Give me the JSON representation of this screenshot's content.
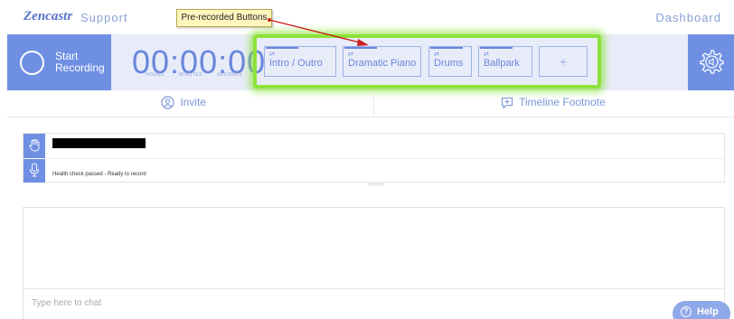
{
  "nav": {
    "logo": "Zencastr",
    "support": "Support",
    "dashboard": "Dashboard"
  },
  "annotation": {
    "callout": "Pre-recorded Buttons"
  },
  "recording": {
    "start_label": "Start Recording",
    "timer": "00:00:00",
    "units": {
      "hours": "HOURS",
      "minutes": "MINUTES",
      "seconds": "SECONDS"
    }
  },
  "prerecorded": [
    {
      "label": "Intro / Outro"
    },
    {
      "label": "Dramatic Piano"
    },
    {
      "label": "Drums"
    },
    {
      "label": "Ballpark"
    },
    {
      "label": "+"
    }
  ],
  "subnav": {
    "invite": "Invite",
    "footnote": "Timeline Footnote"
  },
  "participant": {
    "status": "Health check passed - Ready to record"
  },
  "chat": {
    "placeholder": "Type here to chat"
  },
  "help": {
    "label": "Help"
  },
  "colors": {
    "accent": "#6f8fe3",
    "timer": "#6a86dc",
    "highlight": "#8ce23a",
    "arrow": "#cc1f1f"
  }
}
